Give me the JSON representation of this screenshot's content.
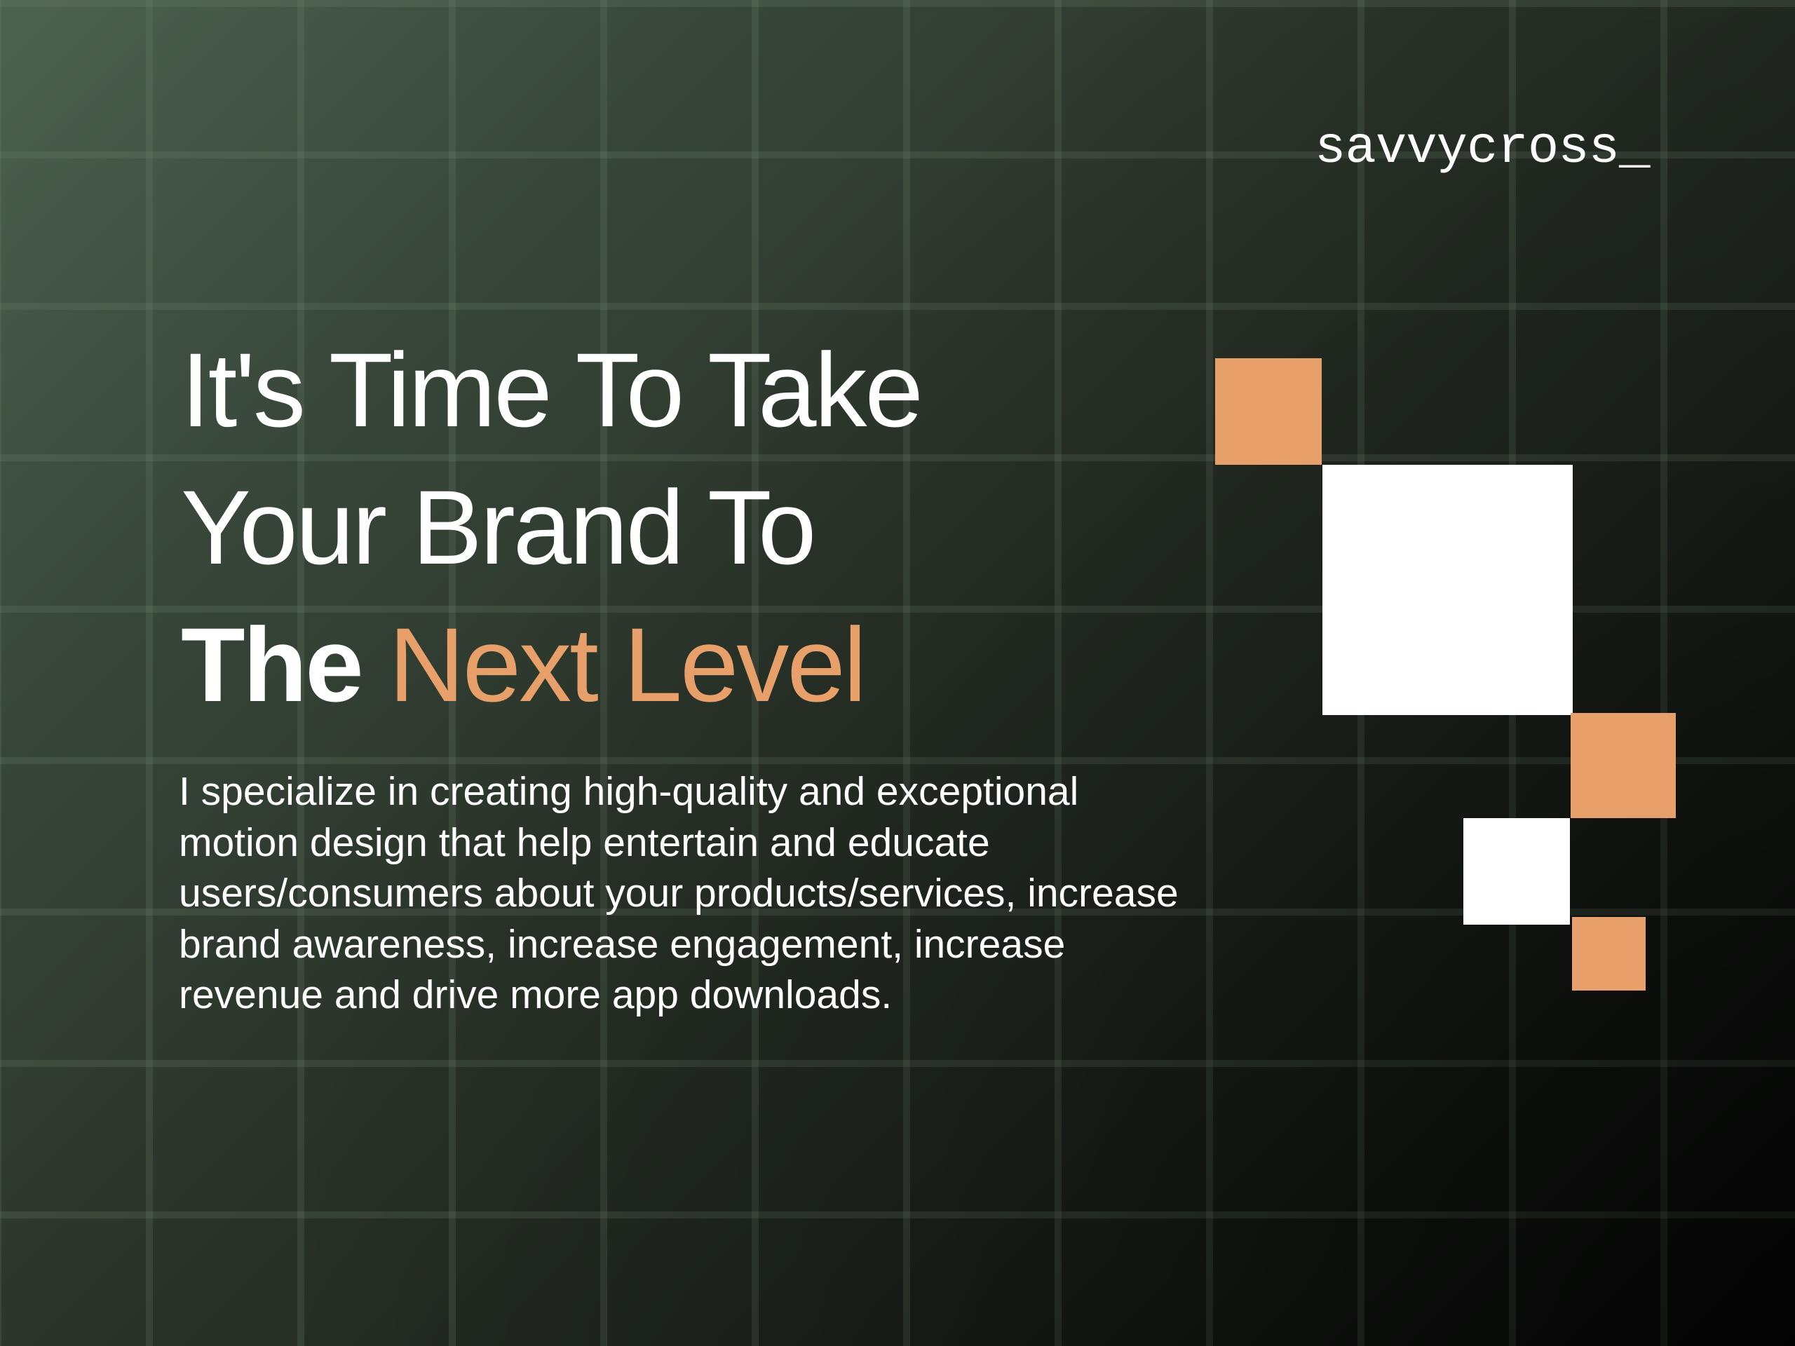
{
  "logo": {
    "text": "savvycross_"
  },
  "headline": {
    "line1": "It's Time To Take",
    "line2": "Your Brand To",
    "line3_prefix": "The",
    "line3_accent": "Next Level"
  },
  "description": {
    "text": "I specialize in creating high-quality and exceptional motion design that help entertain and educate users/consumers about your products/services, increase brand awareness, increase engagement, increase revenue and drive more app downloads."
  },
  "colors": {
    "accent": "#e8a06a",
    "text": "#ffffff",
    "background_start": "#4d624f",
    "background_end": "#050605"
  }
}
